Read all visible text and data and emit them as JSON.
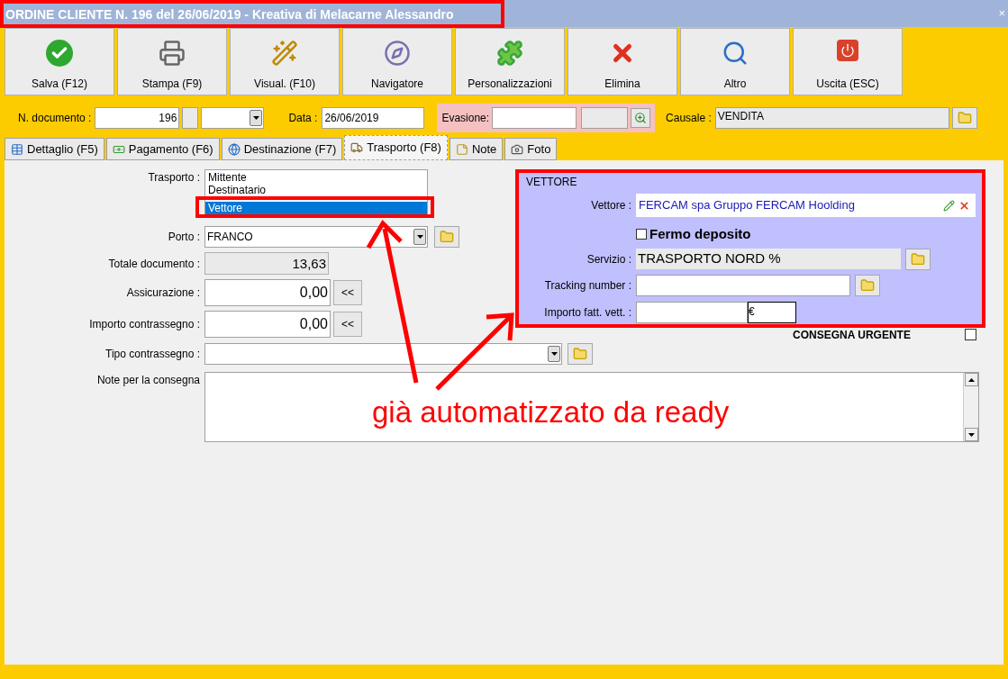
{
  "window": {
    "title": "ORDINE CLIENTE N. 196 del 26/06/2019 - Kreativa di Melacarne Alessandro",
    "close": "×"
  },
  "toolbar": [
    {
      "label": "Salva (F12)"
    },
    {
      "label": "Stampa (F9)"
    },
    {
      "label": "Visual. (F10)"
    },
    {
      "label": "Navigatore"
    },
    {
      "label": "Personalizzazioni"
    },
    {
      "label": "Elimina"
    },
    {
      "label": "Altro"
    },
    {
      "label": "Uscita (ESC)"
    }
  ],
  "header": {
    "doc_number": {
      "label": "N. documento :",
      "value": "196"
    },
    "date": {
      "label": "Data :",
      "value": "26/06/2019"
    },
    "evasione": {
      "label": "Evasione:"
    },
    "causale": {
      "label": "Causale :",
      "value": "VENDITA"
    }
  },
  "tabs": [
    {
      "label": "Dettaglio (F5)",
      "selected": false
    },
    {
      "label": "Pagamento (F6)",
      "selected": false
    },
    {
      "label": "Destinazione (F7)",
      "selected": false
    },
    {
      "label": "Trasporto (F8)",
      "selected": true
    },
    {
      "label": "Note",
      "selected": false
    },
    {
      "label": "Foto",
      "selected": false
    }
  ],
  "trasporto": {
    "label": "Trasporto :",
    "options": [
      {
        "label": "Mittente",
        "selected": false
      },
      {
        "label": "Destinatario",
        "selected": false
      },
      {
        "label": "Vettore",
        "selected": true
      }
    ]
  },
  "porto": {
    "label": "Porto :",
    "value": "FRANCO"
  },
  "totale": {
    "label": "Totale documento :",
    "value": "13,63"
  },
  "assicurazione": {
    "label": "Assicurazione :",
    "value": "0,00",
    "button": "<<"
  },
  "importo_contrassegno": {
    "label": "Importo contrassegno :",
    "value": "0,00",
    "button": "<<"
  },
  "tipo_contrassegno": {
    "label": "Tipo contrassegno :"
  },
  "note": {
    "label": "Note per la consegna"
  },
  "vettore_panel": {
    "title": "VETTORE",
    "vettore": {
      "label": "Vettore :",
      "value": "FERCAM spa Gruppo FERCAM Hoolding"
    },
    "fermo_deposito": {
      "label": "Fermo deposito",
      "checked": false
    },
    "servizio": {
      "label": "Servizio :",
      "value": "TRASPORTO NORD %"
    },
    "tracking": {
      "label": "Tracking number :"
    },
    "importo": {
      "label": "Importo fatt. vett. :",
      "currency": "€"
    }
  },
  "consegna_urgente": {
    "label": "CONSEGNA URGENTE",
    "checked": false
  },
  "annotation": {
    "text": "già automatizzato da ready"
  }
}
